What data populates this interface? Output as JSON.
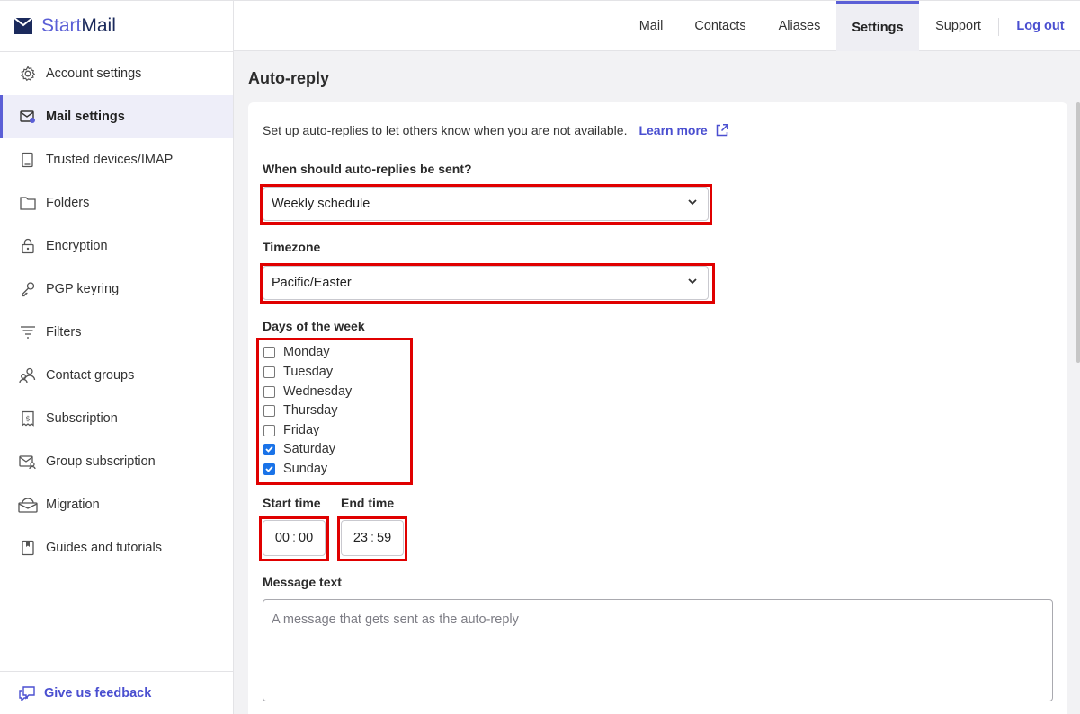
{
  "app": {
    "brand_start": "Start",
    "brand_mail": "Mail"
  },
  "sidebar": {
    "items": [
      {
        "label": "Account settings",
        "icon": "gear-icon"
      },
      {
        "label": "Mail settings",
        "icon": "mail-settings-icon",
        "active": true
      },
      {
        "label": "Trusted devices/IMAP",
        "icon": "device-icon"
      },
      {
        "label": "Folders",
        "icon": "folder-icon"
      },
      {
        "label": "Encryption",
        "icon": "lock-icon"
      },
      {
        "label": "PGP keyring",
        "icon": "key-icon"
      },
      {
        "label": "Filters",
        "icon": "filter-icon"
      },
      {
        "label": "Contact groups",
        "icon": "contact-groups-icon"
      },
      {
        "label": "Subscription",
        "icon": "receipt-icon"
      },
      {
        "label": "Group subscription",
        "icon": "group-mail-icon"
      },
      {
        "label": "Migration",
        "icon": "migration-icon"
      },
      {
        "label": "Guides and tutorials",
        "icon": "book-icon"
      }
    ],
    "feedback": "Give us feedback"
  },
  "topnav": {
    "tabs": [
      "Mail",
      "Contacts",
      "Aliases",
      "Settings",
      "Support"
    ],
    "active": "Settings",
    "logout": "Log out"
  },
  "page": {
    "title": "Auto-reply",
    "intro": "Set up auto-replies to let others know when you are not available.",
    "learn_more": "Learn more",
    "when_label": "When should auto-replies be sent?",
    "when_value": "Weekly schedule",
    "timezone_label": "Timezone",
    "timezone_value": "Pacific/Easter",
    "days_label": "Days of the week",
    "days": [
      {
        "label": "Monday",
        "checked": false
      },
      {
        "label": "Tuesday",
        "checked": false
      },
      {
        "label": "Wednesday",
        "checked": false
      },
      {
        "label": "Thursday",
        "checked": false
      },
      {
        "label": "Friday",
        "checked": false
      },
      {
        "label": "Saturday",
        "checked": true
      },
      {
        "label": "Sunday",
        "checked": true
      }
    ],
    "start_label": "Start time",
    "start_hh": "00",
    "start_mm": "00",
    "end_label": "End time",
    "end_hh": "23",
    "end_mm": "59",
    "message_label": "Message text",
    "message_placeholder": "A message that gets sent as the auto-reply"
  },
  "colors": {
    "accent": "#5b5fd6",
    "highlight": "#e00000",
    "checkbox": "#1a73e8"
  }
}
